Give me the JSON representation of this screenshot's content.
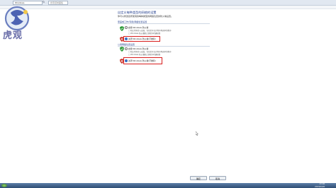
{
  "header": {
    "address_text": "Windows",
    "search_placeholder": "搜索控制面板"
  },
  "logo": {
    "text": "虎观"
  },
  "page": {
    "title": "自定义每种类型的网络的设置",
    "subtitle": "你可以修改您所使用的每种类型的网络位置的防火墙设置。"
  },
  "sections": [
    {
      "label": "家庭或工作(专用)网络位置设置",
      "options": [
        {
          "label": "启用 Windows 防火墙",
          "selected": false
        },
        {
          "label": "阻止所有传入连接，包括位于允许程序列表中的程序",
          "selected": false,
          "disabled": true
        },
        {
          "label": "Windows 防火墙阻止新程序时通知我",
          "selected": false,
          "disabled": true
        },
        {
          "label": "关闭 Windows 防火墙(不推荐)",
          "selected": true
        }
      ]
    },
    {
      "label": "公用网络位置设置",
      "options": [
        {
          "label": "启用 Windows 防火墙",
          "selected": false
        },
        {
          "label": "阻止所有传入连接，包括位于允许程序列表中的程序",
          "selected": false,
          "disabled": true
        },
        {
          "label": "Windows 防火墙阻止新程序时通知我",
          "selected": false,
          "disabled": true
        },
        {
          "label": "关闭 Windows 防火墙(不推荐)",
          "selected": true
        }
      ]
    }
  ],
  "buttons": {
    "ok": "确定",
    "cancel": "取消"
  },
  "taskbar": {
    "time": "13:40",
    "date": "2019/6/20"
  },
  "colors": {
    "highlight": "#d81e1e",
    "title": "#1e3b8c",
    "shield_on": "#2e9b3a",
    "shield_off": "#c8342a"
  }
}
